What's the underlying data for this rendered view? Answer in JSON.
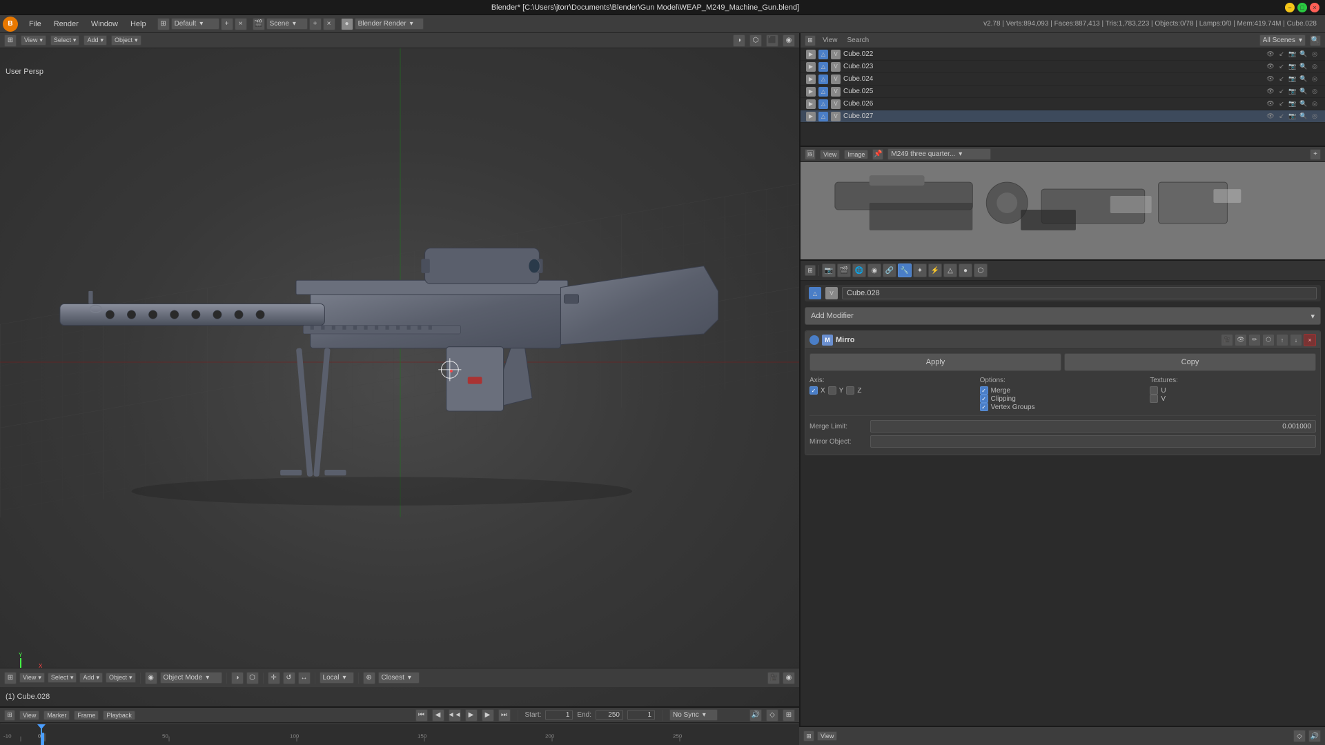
{
  "window": {
    "title": "Blender* [C:\\Users\\jtorr\\Documents\\Blender\\Gun Model\\WEAP_M249_Machine_Gun.blend]",
    "close_label": "×",
    "maximize_label": "□",
    "minimize_label": "−"
  },
  "menubar": {
    "logo": "B",
    "items": [
      "File",
      "Render",
      "Window",
      "Help"
    ],
    "layout_label": "Default",
    "scene_label": "Scene",
    "render_engine_label": "Blender Render"
  },
  "stats": {
    "text": "v2.78 | Verts:894,093 | Faces:887,413 | Tris:1,783,223 | Objects:0/78 | Lamps:0/0 | Mem:419.74M | Cube.028"
  },
  "viewport": {
    "label": "User Persp",
    "object_label": "(1) Cube.028"
  },
  "toolbar": {
    "mode_label": "Object Mode",
    "pivot_label": "Local",
    "snap_label": "Closest",
    "items": [
      "View",
      "Select",
      "Add",
      "Object"
    ]
  },
  "timeline": {
    "start_label": "Start:",
    "start_value": "1",
    "end_label": "End:",
    "end_value": "250",
    "frame_label": "",
    "frame_value": "1",
    "sync_label": "No Sync",
    "items": [
      "-10",
      "0",
      "50",
      "100",
      "150",
      "200",
      "250"
    ],
    "toolbar_items": [
      "View",
      "Marker",
      "Frame",
      "Playback"
    ]
  },
  "outliner": {
    "header": {
      "view_label": "View",
      "search_label": "Search",
      "all_scenes_label": "All Scenes"
    },
    "rows": [
      {
        "name": "Cube.022",
        "type": "mesh"
      },
      {
        "name": "Cube.023",
        "type": "mesh"
      },
      {
        "name": "Cube.024",
        "type": "mesh"
      },
      {
        "name": "Cube.025",
        "type": "mesh"
      },
      {
        "name": "Cube.026",
        "type": "mesh"
      },
      {
        "name": "Cube.027",
        "type": "mesh",
        "selected": true
      }
    ]
  },
  "image_viewer": {
    "header": {
      "view_label": "View",
      "image_label": "Image",
      "image_name": "M249 three quarter..."
    }
  },
  "properties": {
    "object_name": "Cube.028",
    "add_modifier_label": "Add Modifier",
    "modifier": {
      "name": "Mirro",
      "apply_label": "Apply",
      "copy_label": "Copy",
      "axis": {
        "label": "Axis:",
        "x_checked": true,
        "y_checked": false,
        "z_checked": false
      },
      "options": {
        "label": "Options:",
        "merge_checked": true,
        "clipping_checked": true,
        "vertex_groups_checked": true
      },
      "textures": {
        "label": "Textures:",
        "u_checked": false,
        "v_checked": false
      },
      "merge_limit": {
        "label": "Merge Limit:",
        "value": "0.001000"
      },
      "mirror_object": {
        "label": "Mirror Object:"
      }
    },
    "props_icons": [
      "●",
      "▲",
      "♦",
      "⊕",
      "⚙",
      "↺",
      "◐",
      "⊞",
      "✱",
      "⬡",
      "✂",
      "↕",
      "⊗",
      "⊕"
    ]
  }
}
